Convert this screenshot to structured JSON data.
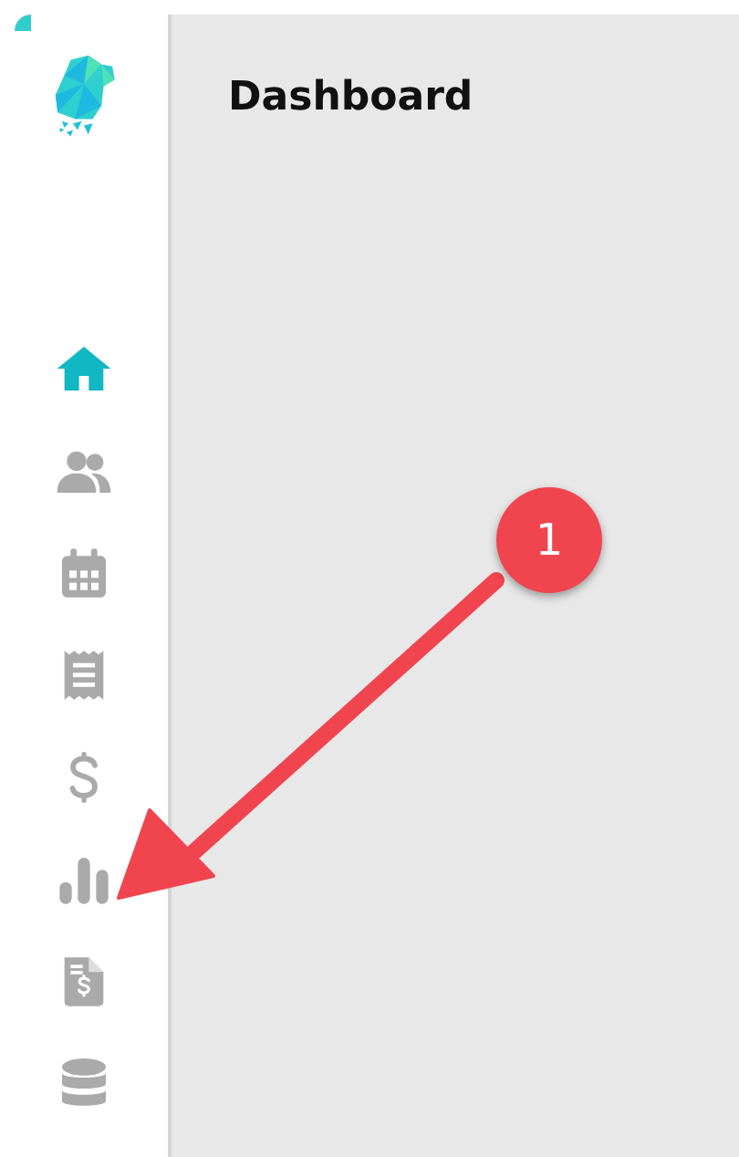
{
  "page": {
    "title": "Dashboard"
  },
  "sidebar": {
    "items": [
      {
        "kind": "home",
        "selected": true
      },
      {
        "kind": "people",
        "selected": false
      },
      {
        "kind": "calendar",
        "selected": false
      },
      {
        "kind": "receipt",
        "selected": false
      },
      {
        "kind": "dollar",
        "selected": false
      },
      {
        "kind": "chart",
        "selected": false
      },
      {
        "kind": "invoice",
        "selected": false
      },
      {
        "kind": "database",
        "selected": false
      }
    ]
  },
  "annotation": {
    "label": "1"
  }
}
